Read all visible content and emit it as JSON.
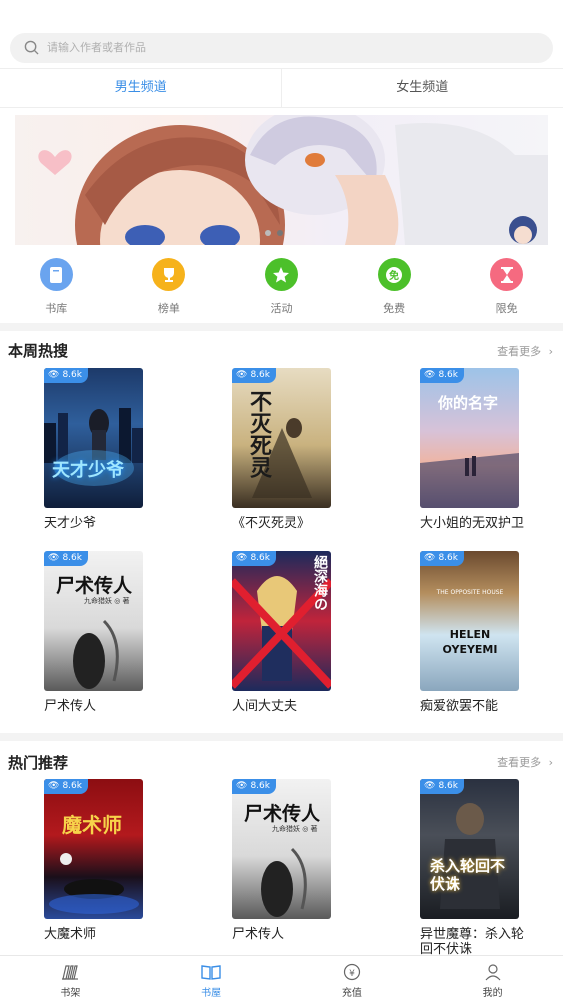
{
  "search": {
    "placeholder": "请输入作者或者作品"
  },
  "tabs": [
    {
      "label": "男生频道",
      "active": true
    },
    {
      "label": "女生频道",
      "active": false
    }
  ],
  "quick_nav": [
    {
      "label": "书库",
      "icon": "book-icon",
      "color": "#6aa4ef"
    },
    {
      "label": "榜单",
      "icon": "trophy-icon",
      "color": "#f6b21b"
    },
    {
      "label": "活动",
      "icon": "star-icon",
      "color": "#4cc02a"
    },
    {
      "label": "免费",
      "icon": "free-icon",
      "color": "#4cc02a"
    },
    {
      "label": "限免",
      "icon": "hourglass-icon",
      "color": "#f56a80"
    }
  ],
  "weekly_hot": {
    "title": "本周热搜",
    "more": "查看更多",
    "books": [
      {
        "title": "天才少爷",
        "views": "8.6k"
      },
      {
        "title": "《不灭死灵》",
        "views": "8.6k"
      },
      {
        "title": "大小姐的无双护卫",
        "views": "8.6k"
      },
      {
        "title": "尸术传人",
        "views": "8.6k"
      },
      {
        "title": "人间大丈夫",
        "views": "8.6k"
      },
      {
        "title": "痴爱欲罢不能",
        "views": "8.6k"
      }
    ]
  },
  "recommend": {
    "title": "热门推荐",
    "more": "查看更多",
    "books": [
      {
        "title": "大魔术师",
        "views": "8.6k"
      },
      {
        "title": "尸术传人",
        "views": "8.6k"
      },
      {
        "title": "异世魔尊：杀入轮回不伏诛",
        "views": "8.6k"
      }
    ]
  },
  "covers": {
    "c1": "天才少爷",
    "c2": "不灭死灵",
    "c3": "你的名字",
    "c4": "尸术传人",
    "c4b": "九命猎妖 ◎ 著",
    "c5": "絕深海の",
    "c6a": "THE OPPOSITE HOUSE",
    "c6b": "HELEN OYEYEMI",
    "c7": "魔术师",
    "c9": "杀入轮回不伏诛"
  },
  "bottom_nav": [
    {
      "label": "书架",
      "active": false
    },
    {
      "label": "书屋",
      "active": true
    },
    {
      "label": "充值",
      "active": false
    },
    {
      "label": "我的",
      "active": false
    }
  ],
  "colors": {
    "accent": "#3a8ee6",
    "badge": "#3b8fe8"
  }
}
